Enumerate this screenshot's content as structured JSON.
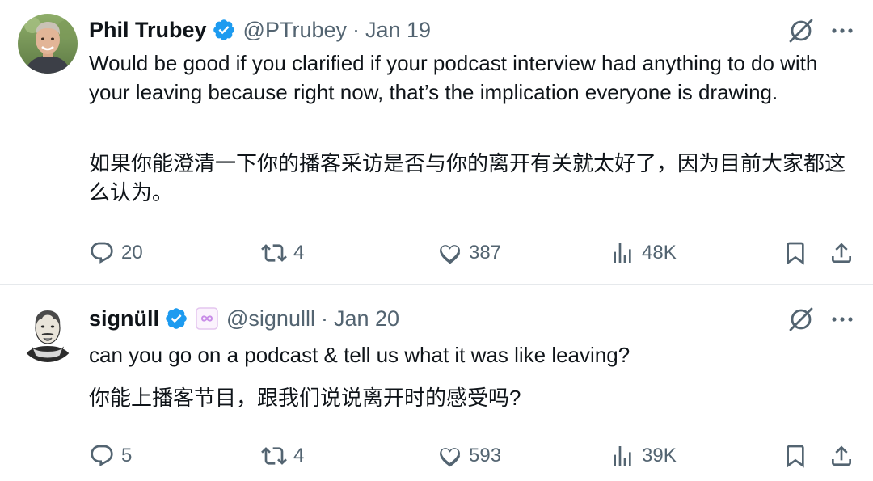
{
  "tweets": [
    {
      "author_name": "Phil Trubey",
      "handle": "@PTrubey",
      "separator": "·",
      "date": "Jan 19",
      "text_en": "Would be good if you clarified if your podcast interview had anything to do with your leaving because right now, that’s the implication everyone is drawing.",
      "text_zh": "如果你能澄清一下你的播客采访是否与你的离开有关就太好了，因为目前大家都这么认为。",
      "replies": "20",
      "retweets": "4",
      "likes": "387",
      "views": "48K"
    },
    {
      "author_name": "signüll",
      "handle": "@signulll",
      "separator": "·",
      "date": "Jan 20",
      "text_en": "can you go on a podcast & tell us what it was like leaving?",
      "text_zh": "你能上播客节目，跟我们说说离开时的感受吗?",
      "replies": "5",
      "retweets": "4",
      "likes": "593",
      "views": "39K"
    }
  ],
  "colors": {
    "text": "#0f1419",
    "secondary": "#536471",
    "verified": "#1d9bf0",
    "badge": "#c98de8",
    "divider": "#e6e9ec"
  },
  "icons": [
    "avatar",
    "verified-badge-icon",
    "affiliate-badge-icon",
    "grok-icon",
    "more-icon",
    "reply-icon",
    "retweet-icon",
    "like-icon",
    "views-icon",
    "bookmark-icon",
    "share-icon"
  ]
}
